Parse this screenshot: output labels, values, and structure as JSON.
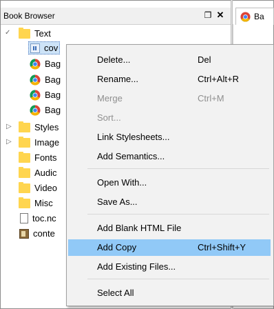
{
  "panel": {
    "title": "Book Browser",
    "float_glyph": "❐",
    "close_glyph": "✕"
  },
  "editor_tab": {
    "label": "Ba"
  },
  "tree": {
    "text_folder": "Text",
    "cover_item": "cov",
    "html_items": [
      "Bag",
      "Bag",
      "Bag",
      "Bag"
    ],
    "styles": "Styles",
    "images": "Image",
    "fonts": "Fonts",
    "audio": "Audic",
    "video": "Video",
    "misc": "Misc",
    "toc": "toc.nc",
    "content": "conte"
  },
  "context_menu": {
    "items": [
      {
        "label": "Delete...",
        "shortcut": "Del"
      },
      {
        "label": "Rename...",
        "shortcut": "Ctrl+Alt+R"
      },
      {
        "label": "Merge",
        "shortcut": "Ctrl+M"
      },
      {
        "label": "Sort...",
        "shortcut": ""
      },
      {
        "label": "Link Stylesheets...",
        "shortcut": ""
      },
      {
        "label": "Add Semantics...",
        "shortcut": ""
      },
      {
        "label": "Open With...",
        "shortcut": ""
      },
      {
        "label": "Save As...",
        "shortcut": ""
      },
      {
        "label": "Add Blank HTML File",
        "shortcut": ""
      },
      {
        "label": "Add Copy",
        "shortcut": "Ctrl+Shift+Y"
      },
      {
        "label": "Add Existing Files...",
        "shortcut": ""
      },
      {
        "label": "Select All",
        "shortcut": ""
      }
    ]
  },
  "colors": {
    "menu_highlight": "#91c9f7",
    "folder": "#ffd54f",
    "disabled_text": "#8f8f8f"
  },
  "icons": [
    "chrome-icon",
    "folder-icon",
    "html-file-icon",
    "document-icon",
    "opf-icon",
    "expand-arrow-icon",
    "collapse-arrow-icon",
    "float-icon",
    "close-icon"
  ]
}
